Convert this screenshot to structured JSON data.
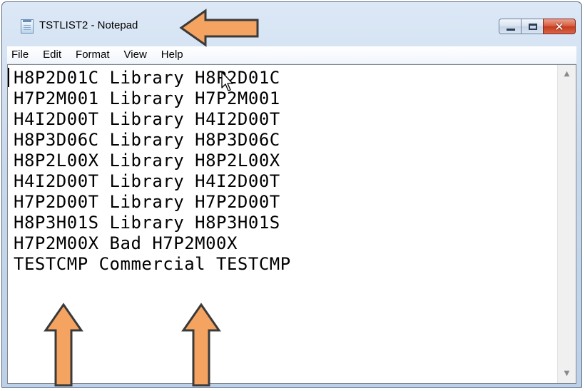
{
  "window": {
    "title": "TSTLIST2 - Notepad",
    "close_glyph": "✕"
  },
  "menu": [
    "File",
    "Edit",
    "Format",
    "View",
    "Help"
  ],
  "editor": {
    "lines": [
      "H8P2D01C Library H8P2D01C",
      "H7P2M001 Library H7P2M001",
      "H4I2D00T Library H4I2D00T",
      "H8P3D06C Library H8P3D06C",
      "H8P2L00X Library H8P2L00X",
      "H4I2D00T Library H4I2D00T",
      "H7P2D00T Library H7P2D00T",
      "H8P3H01S Library H8P3H01S",
      "H7P2M00X Bad H7P2M00X",
      "TESTCMP Commercial TESTCMP"
    ]
  },
  "scrollbar": {
    "up_glyph": "▲",
    "down_glyph": "▼"
  },
  "annotations": {
    "arrow_color": "#f4a460",
    "arrow_stroke": "#3a3a3a"
  }
}
